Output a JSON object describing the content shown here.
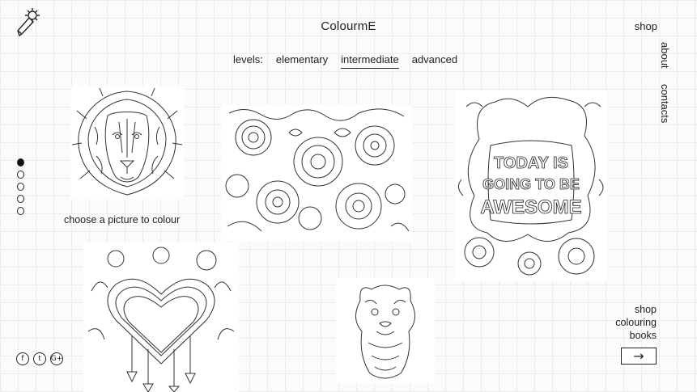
{
  "header": {
    "logo_icon": "pencil-sparkle-icon",
    "brand": "ColourmE",
    "shop": "shop",
    "about": "about",
    "contacts": "contacts"
  },
  "levels": {
    "label": "levels:",
    "options": [
      "elementary",
      "intermediate",
      "advanced"
    ],
    "selected": "intermediate"
  },
  "pagination": {
    "total": 5,
    "current": 1
  },
  "gallery": {
    "caption": "choose a picture to colour",
    "pictures": [
      {
        "name": "lion"
      },
      {
        "name": "flowers"
      },
      {
        "name": "today-is-going-to-be-awesome",
        "text": [
          "TODAY IS",
          "GOING TO BE",
          "AWESOME"
        ]
      },
      {
        "name": "heart-dreamcatcher"
      },
      {
        "name": "puppy"
      }
    ]
  },
  "social": [
    "f",
    "t",
    "G+"
  ],
  "promo": {
    "line1": "shop",
    "line2": "colouring",
    "line3": "books",
    "arrow": "→"
  }
}
